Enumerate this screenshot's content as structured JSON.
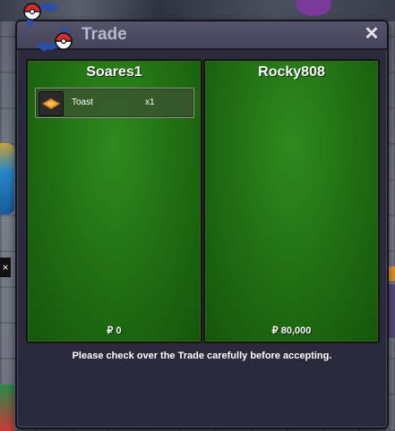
{
  "window": {
    "title": "Trade",
    "close_icon": "close-icon",
    "logo_icon": "trade-swap-pokeball-icon"
  },
  "left_panel": {
    "player_name": "Soares1",
    "items": [
      {
        "icon": "toast-icon",
        "name": "Toast",
        "quantity": "x1"
      }
    ],
    "money": "₽ 0"
  },
  "right_panel": {
    "player_name": "Rocky808",
    "items": [],
    "money": "₽ 80,000"
  },
  "notice": "Please check over the Trade carefully before accepting.",
  "colors": {
    "panel_green": "#1f6c12",
    "window_bg": "#2b2a3c",
    "title_bar": "#4a495e",
    "title_text": "#b9b8c8",
    "logo_blue": "#2b4fa8",
    "logo_red": "#d42a2a"
  }
}
